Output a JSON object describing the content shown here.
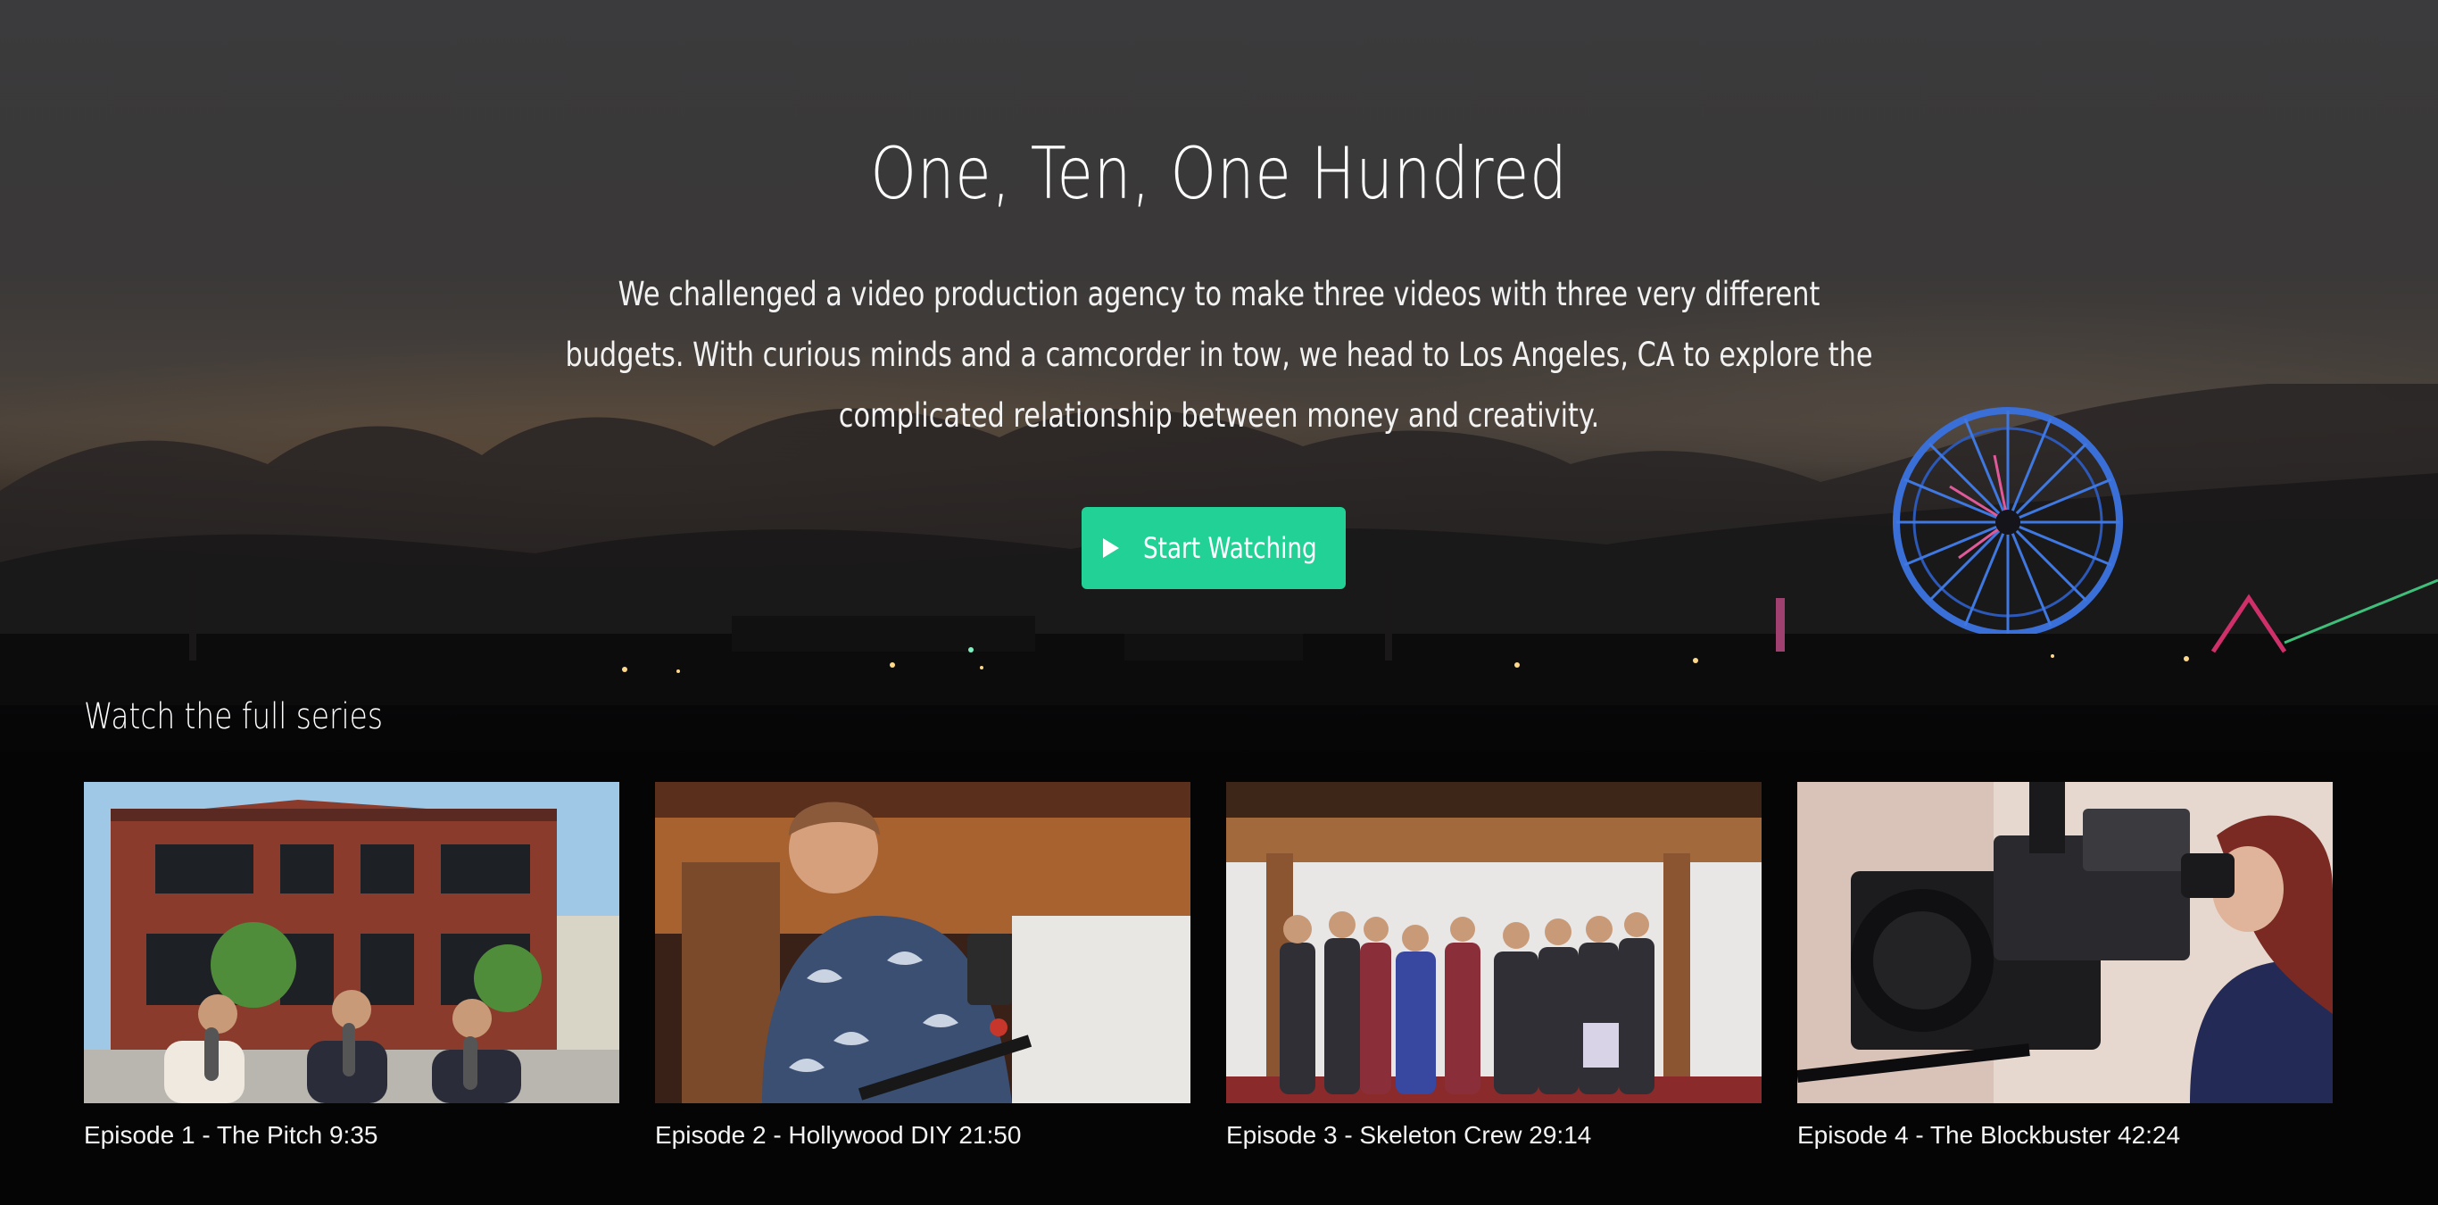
{
  "hero": {
    "title": "One, Ten, One Hundred",
    "description": "We challenged a video production agency to make three videos with three very different budgets. With curious minds and a camcorder in tow, we head to Los Angeles, CA to explore the complicated relationship between money and creativity.",
    "cta_label": "Start Watching",
    "cta_icon": "play-icon"
  },
  "colors": {
    "accent": "#21d196",
    "background": "#050506"
  },
  "series": {
    "heading": "Watch the full series",
    "episodes": [
      {
        "label": "Episode 1 - The Pitch 9:35"
      },
      {
        "label": "Episode 2 - Hollywood DIY 21:50"
      },
      {
        "label": "Episode 3 - Skeleton Crew 29:14"
      },
      {
        "label": "Episode 4 - The Blockbuster 42:24"
      }
    ]
  }
}
